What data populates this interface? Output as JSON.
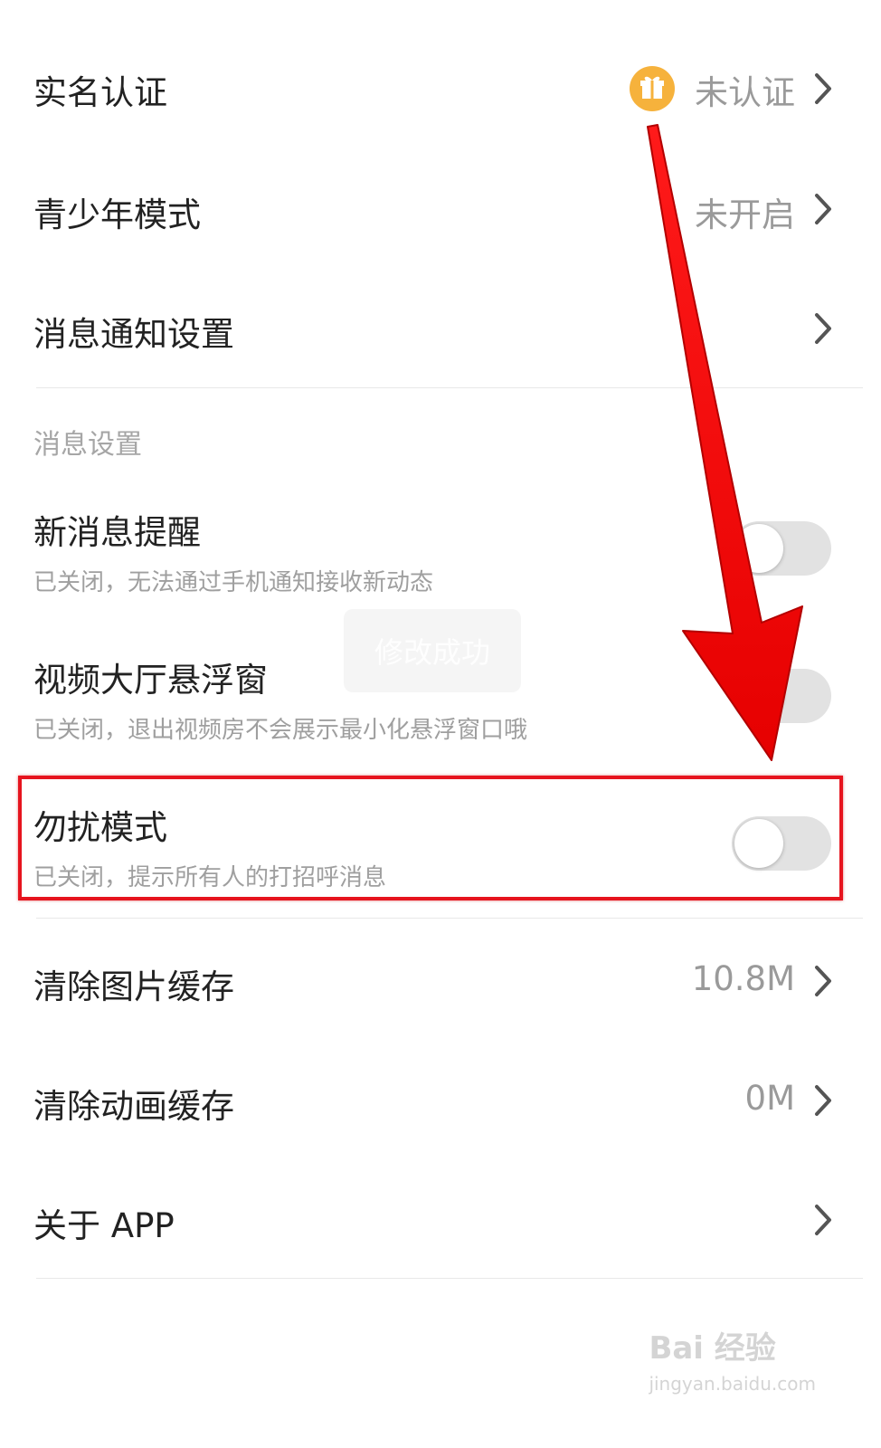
{
  "settings": {
    "real_name": {
      "label": "实名认证",
      "value": "未认证"
    },
    "teen_mode": {
      "label": "青少年模式",
      "value": "未开启"
    },
    "notification": {
      "label": "消息通知设置"
    },
    "section_title": "消息设置",
    "new_message": {
      "label": "新消息提醒",
      "desc": "已关闭，无法通过手机通知接收新动态",
      "enabled": false
    },
    "float_window": {
      "label": "视频大厅悬浮窗",
      "desc": "已关闭，退出视频房不会展示最小化悬浮窗口哦",
      "enabled": false
    },
    "dnd": {
      "label": "勿扰模式",
      "desc": "已关闭，提示所有人的打招呼消息",
      "enabled": false
    },
    "clear_image": {
      "label": "清除图片缓存",
      "value": "10.8M"
    },
    "clear_anim": {
      "label": "清除动画缓存",
      "value": "0M"
    },
    "about": {
      "label": "关于 APP"
    }
  },
  "toast": {
    "text": "修改成功"
  },
  "watermark": {
    "main": "Bai 经验",
    "sub": "jingyan.baidu.com"
  },
  "colors": {
    "accent_gift": "#f6b23c",
    "highlight": "#e6141e",
    "arrow": "#ff0000"
  }
}
